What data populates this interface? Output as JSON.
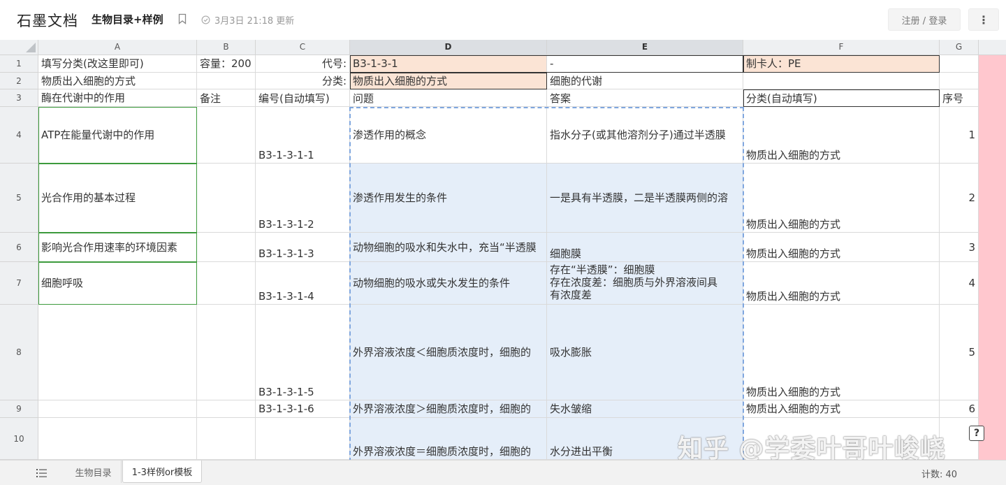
{
  "header": {
    "brand": "石墨文档",
    "doc_title": "生物目录+样例",
    "status": "3月3日 21:18 更新",
    "login_label": "注册 / 登录",
    "more_label": "⋮"
  },
  "grid": {
    "columns": [
      "A",
      "B",
      "C",
      "D",
      "E",
      "F",
      "G"
    ],
    "rows": [
      "1",
      "2",
      "3",
      "4",
      "5",
      "6",
      "7",
      "8",
      "9",
      "10"
    ],
    "cells": {
      "r1": {
        "a": "填写分类(改这里即可)",
        "b": "容量：200",
        "c": "代号:",
        "d": "B3-1-3-1",
        "e": "-",
        "f": "制卡人：PE",
        "g": ""
      },
      "r2": {
        "a": "物质出入细胞的方式",
        "b": "",
        "c": "分类:",
        "d": "物质出入细胞的方式",
        "e": "细胞的代谢",
        "f": "",
        "g": ""
      },
      "r3": {
        "a": "酶在代谢中的作用",
        "b": "备注",
        "c": "编号(自动填写)",
        "d": "问题",
        "e": "答案",
        "f": "分类(自动填写)",
        "g": "序号"
      },
      "r4": {
        "a": "ATP在能量代谢中的作用",
        "b": "",
        "c": "B3-1-3-1-1",
        "d": "渗透作用的概念",
        "e": "指水分子(或其他溶剂分子)通过半透膜",
        "f": "物质出入细胞的方式",
        "g": "1"
      },
      "r5": {
        "a": "光合作用的基本过程",
        "b": "",
        "c": "B3-1-3-1-2",
        "d": "渗透作用发生的条件",
        "e": "一是具有半透膜，二是半透膜两侧的溶",
        "f": "物质出入细胞的方式",
        "g": "2"
      },
      "r6": {
        "a": "影响光合作用速率的环境因素",
        "b": "",
        "c": "B3-1-3-1-3",
        "d": "动物细胞的吸水和失水中，充当“半透膜",
        "e": "细胞膜",
        "f": "物质出入细胞的方式",
        "g": "3"
      },
      "r7": {
        "a": "细胞呼吸",
        "b": "",
        "c": "B3-1-3-1-4",
        "d": "动物细胞的吸水或失水发生的条件",
        "e1": "存在“半透膜”：细胞膜",
        "e2": "存在浓度差：细胞质与外界溶液间具",
        "e3": "有浓度差",
        "f": "物质出入细胞的方式",
        "g": "4"
      },
      "r8": {
        "a": "",
        "b": "",
        "c": "B3-1-3-1-5",
        "d": "外界溶液浓度＜细胞质浓度时，细胞的",
        "e": "吸水膨胀",
        "f": "物质出入细胞的方式",
        "g": "5"
      },
      "r9": {
        "a": "",
        "b": "",
        "c": "B3-1-3-1-6",
        "d": "外界溶液浓度＞细胞质浓度时，细胞的",
        "e": "失水皱缩",
        "f": "物质出入细胞的方式",
        "g": "6"
      },
      "r10": {
        "a": "",
        "b": "",
        "c": "",
        "d": "外界溶液浓度＝细胞质浓度时，细胞的",
        "e": "水分进出平衡",
        "f": "",
        "g": ""
      }
    }
  },
  "watermark": "知乎 @学委叶哥叶峻峣",
  "help_label": "?",
  "footer": {
    "tabs": [
      "生物目录",
      "1-3样例or模板"
    ],
    "active_tab": "1-3样例or模板",
    "count": "计数: 40"
  },
  "colors": {
    "peach": "#fbe4d5",
    "selection_blue": "#e5eef9",
    "selection_border": "#7fa6de",
    "pink_column": "#ffc7ce",
    "green_border": "#3c9a3c"
  }
}
